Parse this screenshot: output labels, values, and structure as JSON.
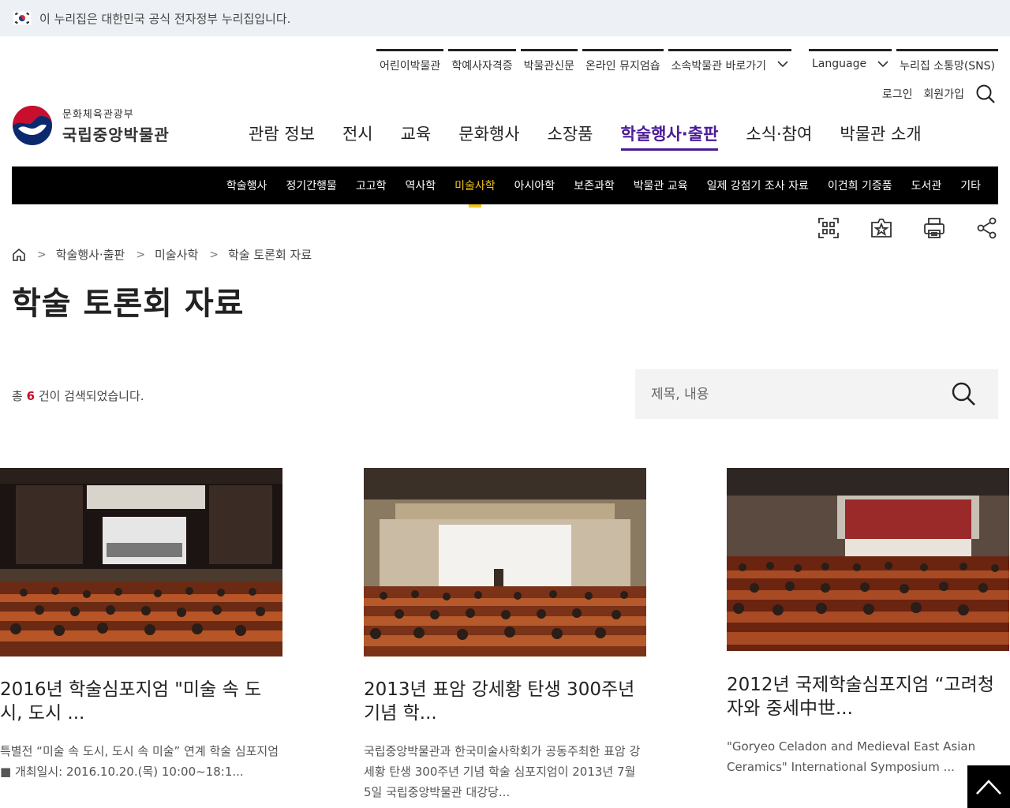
{
  "gov_banner": {
    "text": "이 누리집은 대한민국 공식 전자정부 누리집입니다."
  },
  "utility_nav": {
    "group1": [
      "어린이박물관",
      "학예사자격증",
      "박물관신문",
      "온라인 뮤지엄숍"
    ],
    "affiliated": "소속박물관 바로가기",
    "language": "Language",
    "sns": "누리집 소통망(SNS)",
    "login": "로그인",
    "signup": "회원가입"
  },
  "logo": {
    "ministry": "문화체육관광부",
    "name": "국립중앙박물관"
  },
  "main_nav": [
    "관람 정보",
    "전시",
    "교육",
    "문화행사",
    "소장품",
    "학술행사·출판",
    "소식·참여",
    "박물관 소개"
  ],
  "main_nav_active": "학술행사·출판",
  "sub_nav": [
    "학술행사",
    "정기간행물",
    "고고학",
    "역사학",
    "미술사학",
    "아시아학",
    "보존과학",
    "박물관 교육",
    "일제 강점기 조사 자료",
    "이건희 기증품",
    "도서관",
    "기타"
  ],
  "sub_nav_active": "미술사학",
  "breadcrumb": [
    "학술행사·출판",
    "미술사학",
    "학술 토론회 자료"
  ],
  "page_title": "학술 토론회 자료",
  "result": {
    "prefix": "총",
    "count": "6",
    "suffix": "건이 검색되었습니다."
  },
  "search": {
    "placeholder": "제목, 내용"
  },
  "cards": [
    {
      "title": "2016년 학술심포지엄 \"미술 속 도시, 도시 ...",
      "desc": "특별전 “미술 속 도시, 도시 속 미술” 연계 학술 심포지엄 ■ 개최일시: 2016.10.20.(목) 10:00~18:1..."
    },
    {
      "title": "2013년 표암 강세황 탄생 300주년 기념 학...",
      "desc": "국립중앙박물관과 한국미술사학회가 공동주최한 표암 강세황 탄생 300주년 기념 학술 심포지엄이 2013년 7월 5일 국립중앙박물관 대강당..."
    },
    {
      "title": "2012년 국제학술심포지엄 “고려청자와 중세中世...",
      "desc": "\"Goryeo Celadon and Medieval East Asian Ceramics\" International Symposium ..."
    }
  ],
  "colors": {
    "accent": "#4b1b96",
    "subnav_active": "#f5c518",
    "count": "#c0102a"
  }
}
